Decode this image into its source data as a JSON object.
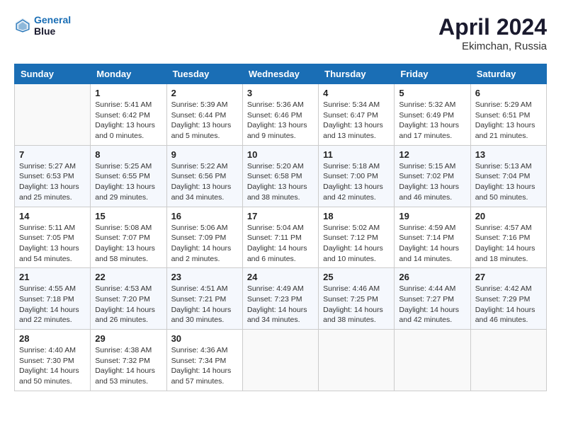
{
  "header": {
    "logo_line1": "General",
    "logo_line2": "Blue",
    "month_year": "April 2024",
    "location": "Ekimchan, Russia"
  },
  "weekdays": [
    "Sunday",
    "Monday",
    "Tuesday",
    "Wednesday",
    "Thursday",
    "Friday",
    "Saturday"
  ],
  "weeks": [
    [
      {
        "day": "",
        "info": ""
      },
      {
        "day": "1",
        "info": "Sunrise: 5:41 AM\nSunset: 6:42 PM\nDaylight: 13 hours\nand 0 minutes."
      },
      {
        "day": "2",
        "info": "Sunrise: 5:39 AM\nSunset: 6:44 PM\nDaylight: 13 hours\nand 5 minutes."
      },
      {
        "day": "3",
        "info": "Sunrise: 5:36 AM\nSunset: 6:46 PM\nDaylight: 13 hours\nand 9 minutes."
      },
      {
        "day": "4",
        "info": "Sunrise: 5:34 AM\nSunset: 6:47 PM\nDaylight: 13 hours\nand 13 minutes."
      },
      {
        "day": "5",
        "info": "Sunrise: 5:32 AM\nSunset: 6:49 PM\nDaylight: 13 hours\nand 17 minutes."
      },
      {
        "day": "6",
        "info": "Sunrise: 5:29 AM\nSunset: 6:51 PM\nDaylight: 13 hours\nand 21 minutes."
      }
    ],
    [
      {
        "day": "7",
        "info": "Sunrise: 5:27 AM\nSunset: 6:53 PM\nDaylight: 13 hours\nand 25 minutes."
      },
      {
        "day": "8",
        "info": "Sunrise: 5:25 AM\nSunset: 6:55 PM\nDaylight: 13 hours\nand 29 minutes."
      },
      {
        "day": "9",
        "info": "Sunrise: 5:22 AM\nSunset: 6:56 PM\nDaylight: 13 hours\nand 34 minutes."
      },
      {
        "day": "10",
        "info": "Sunrise: 5:20 AM\nSunset: 6:58 PM\nDaylight: 13 hours\nand 38 minutes."
      },
      {
        "day": "11",
        "info": "Sunrise: 5:18 AM\nSunset: 7:00 PM\nDaylight: 13 hours\nand 42 minutes."
      },
      {
        "day": "12",
        "info": "Sunrise: 5:15 AM\nSunset: 7:02 PM\nDaylight: 13 hours\nand 46 minutes."
      },
      {
        "day": "13",
        "info": "Sunrise: 5:13 AM\nSunset: 7:04 PM\nDaylight: 13 hours\nand 50 minutes."
      }
    ],
    [
      {
        "day": "14",
        "info": "Sunrise: 5:11 AM\nSunset: 7:05 PM\nDaylight: 13 hours\nand 54 minutes."
      },
      {
        "day": "15",
        "info": "Sunrise: 5:08 AM\nSunset: 7:07 PM\nDaylight: 13 hours\nand 58 minutes."
      },
      {
        "day": "16",
        "info": "Sunrise: 5:06 AM\nSunset: 7:09 PM\nDaylight: 14 hours\nand 2 minutes."
      },
      {
        "day": "17",
        "info": "Sunrise: 5:04 AM\nSunset: 7:11 PM\nDaylight: 14 hours\nand 6 minutes."
      },
      {
        "day": "18",
        "info": "Sunrise: 5:02 AM\nSunset: 7:12 PM\nDaylight: 14 hours\nand 10 minutes."
      },
      {
        "day": "19",
        "info": "Sunrise: 4:59 AM\nSunset: 7:14 PM\nDaylight: 14 hours\nand 14 minutes."
      },
      {
        "day": "20",
        "info": "Sunrise: 4:57 AM\nSunset: 7:16 PM\nDaylight: 14 hours\nand 18 minutes."
      }
    ],
    [
      {
        "day": "21",
        "info": "Sunrise: 4:55 AM\nSunset: 7:18 PM\nDaylight: 14 hours\nand 22 minutes."
      },
      {
        "day": "22",
        "info": "Sunrise: 4:53 AM\nSunset: 7:20 PM\nDaylight: 14 hours\nand 26 minutes."
      },
      {
        "day": "23",
        "info": "Sunrise: 4:51 AM\nSunset: 7:21 PM\nDaylight: 14 hours\nand 30 minutes."
      },
      {
        "day": "24",
        "info": "Sunrise: 4:49 AM\nSunset: 7:23 PM\nDaylight: 14 hours\nand 34 minutes."
      },
      {
        "day": "25",
        "info": "Sunrise: 4:46 AM\nSunset: 7:25 PM\nDaylight: 14 hours\nand 38 minutes."
      },
      {
        "day": "26",
        "info": "Sunrise: 4:44 AM\nSunset: 7:27 PM\nDaylight: 14 hours\nand 42 minutes."
      },
      {
        "day": "27",
        "info": "Sunrise: 4:42 AM\nSunset: 7:29 PM\nDaylight: 14 hours\nand 46 minutes."
      }
    ],
    [
      {
        "day": "28",
        "info": "Sunrise: 4:40 AM\nSunset: 7:30 PM\nDaylight: 14 hours\nand 50 minutes."
      },
      {
        "day": "29",
        "info": "Sunrise: 4:38 AM\nSunset: 7:32 PM\nDaylight: 14 hours\nand 53 minutes."
      },
      {
        "day": "30",
        "info": "Sunrise: 4:36 AM\nSunset: 7:34 PM\nDaylight: 14 hours\nand 57 minutes."
      },
      {
        "day": "",
        "info": ""
      },
      {
        "day": "",
        "info": ""
      },
      {
        "day": "",
        "info": ""
      },
      {
        "day": "",
        "info": ""
      }
    ]
  ]
}
